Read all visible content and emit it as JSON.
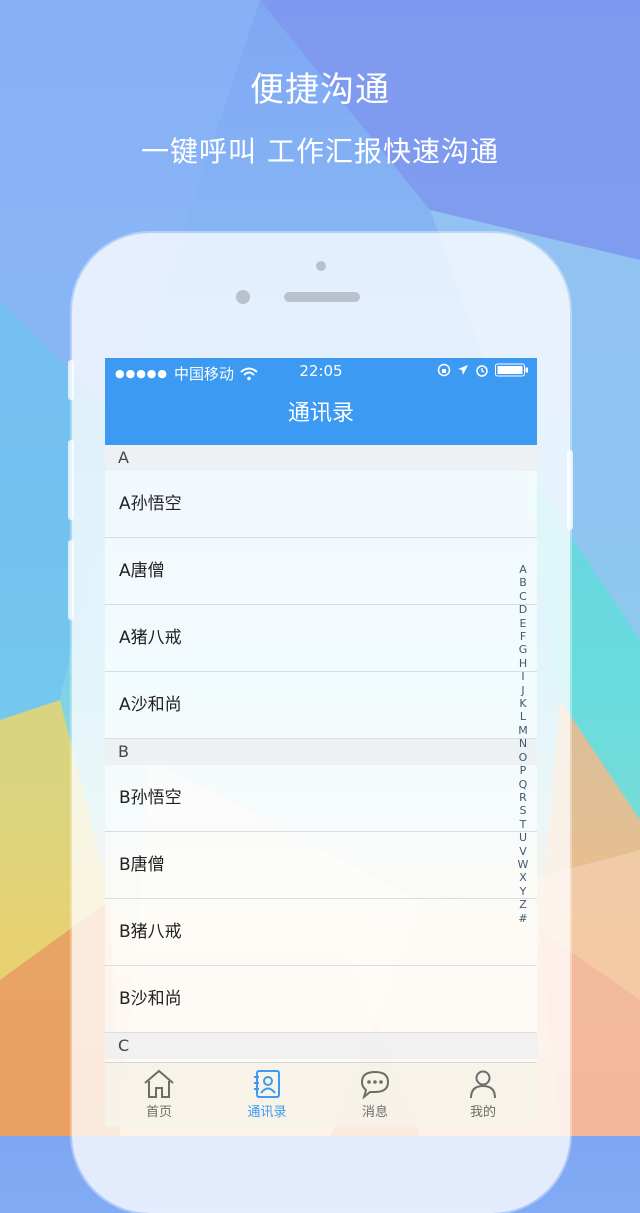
{
  "promo": {
    "title": "便捷沟通",
    "subtitle": "一键呼叫 工作汇报快速沟通"
  },
  "statusbar": {
    "signal": "●●●●●",
    "carrier": "中国移动",
    "time": "22:05"
  },
  "navbar": {
    "title": "通讯录"
  },
  "contacts": {
    "sections": [
      {
        "letter": "A",
        "items": [
          "A孙悟空",
          "A唐僧",
          "A猪八戒",
          "A沙和尚"
        ]
      },
      {
        "letter": "B",
        "items": [
          "B孙悟空",
          "B唐僧",
          "B猪八戒",
          "B沙和尚"
        ]
      },
      {
        "letter": "C",
        "items": []
      }
    ]
  },
  "index_letters": [
    "A",
    "B",
    "C",
    "D",
    "E",
    "F",
    "G",
    "H",
    "I",
    "J",
    "K",
    "L",
    "M",
    "N",
    "O",
    "P",
    "Q",
    "R",
    "S",
    "T",
    "U",
    "V",
    "W",
    "X",
    "Y",
    "Z",
    "#"
  ],
  "tabs": [
    {
      "label": "首页",
      "icon": "home-icon"
    },
    {
      "label": "通讯录",
      "icon": "contacts-icon",
      "active": true
    },
    {
      "label": "消息",
      "icon": "chat-bubble-icon"
    },
    {
      "label": "我的",
      "icon": "user-icon"
    }
  ],
  "colors": {
    "accent": "#3d9af3",
    "bg_top": "#7fa6f3",
    "bg_bottom": "#eaa067"
  }
}
